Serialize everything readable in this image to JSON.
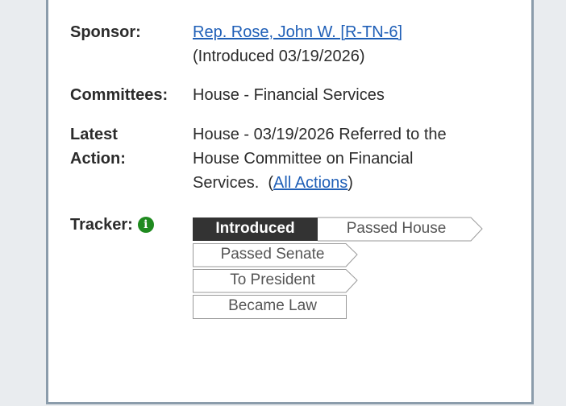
{
  "sponsor": {
    "label": "Sponsor:",
    "name": "Rep. Rose, John W. [R-TN-6]",
    "introduced": "(Introduced 03/19/2026)"
  },
  "committees": {
    "label": "Committees:",
    "value": "House - Financial Services"
  },
  "latest_action": {
    "label_line1": "Latest",
    "label_line2": "Action:",
    "line1": "House - 03/19/2026 Referred to the",
    "line2": "House Committee on Financial",
    "line3_prefix": "Services.  (",
    "all_actions": "All Actions",
    "line3_suffix": ")"
  },
  "tracker": {
    "label": "Tracker:",
    "info_icon": "info-icon",
    "steps": [
      "Introduced",
      "Passed House",
      "Passed Senate",
      "To President",
      "Became Law"
    ],
    "current": "Introduced"
  },
  "colors": {
    "link": "#1f5fb7",
    "active_step": "#333333",
    "info_icon": "#1f8a1f",
    "card_border": "#8b9cab"
  }
}
